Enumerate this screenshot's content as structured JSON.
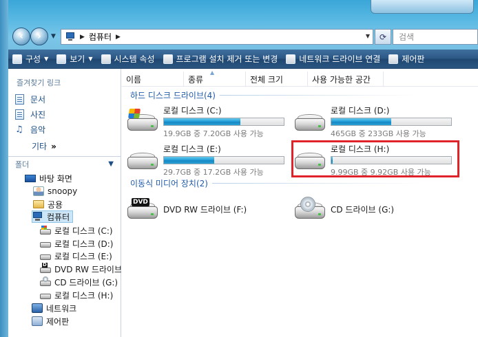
{
  "address": {
    "crumb": "컴퓨터",
    "search_placeholder": "검색"
  },
  "toolbar": {
    "organize": "구성",
    "views": "보기",
    "system_properties": "시스템 속성",
    "uninstall": "프로그램 설치 제거 또는 변경",
    "map_drive": "네트워크 드라이브 연결",
    "control_panel": "제어판"
  },
  "nav": {
    "favorites_header": "즐겨찾기 링크",
    "favorites": [
      {
        "label": "문서",
        "icon": "documents-icon"
      },
      {
        "label": "사진",
        "icon": "pictures-icon"
      },
      {
        "label": "음악",
        "icon": "music-icon"
      }
    ],
    "more": "기타",
    "more_chevron": "»",
    "folders_header": "폴더",
    "tree": [
      {
        "label": "바탕 화면",
        "icon": "desktop-icon"
      },
      {
        "label": "snoopy",
        "icon": "user-folder-icon"
      },
      {
        "label": "공용",
        "icon": "folder-icon"
      },
      {
        "label": "컴퓨터",
        "icon": "computer-icon",
        "selected": true
      },
      {
        "label": "로컬 디스크 (C:)",
        "icon": "windows-drive-icon"
      },
      {
        "label": "로컬 디스크 (D:)",
        "icon": "hard-drive-icon"
      },
      {
        "label": "로컬 디스크 (E:)",
        "icon": "hard-drive-icon"
      },
      {
        "label": "DVD RW 드라이브",
        "icon": "dvd-drive-icon"
      },
      {
        "label": "CD 드라이브 (G:)",
        "icon": "cd-drive-icon"
      },
      {
        "label": "로컬 디스크 (H:)",
        "icon": "hard-drive-icon"
      },
      {
        "label": "네트워크",
        "icon": "network-icon"
      },
      {
        "label": "제어판",
        "icon": "control-panel-icon"
      }
    ]
  },
  "columns": [
    "이름",
    "종류",
    "전체 크기",
    "사용 가능한 공간"
  ],
  "groups": {
    "hard_disks": "하드 디스크 드라이브(4)",
    "removable": "이동식 미디어 장치(2)"
  },
  "drives": [
    {
      "name": "로컬 디스크 (C:)",
      "free_text": "19.9GB 중 7.20GB 사용 가능",
      "used_fraction": 0.64,
      "icon": "windows-drive-icon"
    },
    {
      "name": "로컬 디스크 (D:)",
      "free_text": "465GB 중 233GB 사용 가능",
      "used_fraction": 0.5,
      "icon": "hard-drive-icon"
    },
    {
      "name": "로컬 디스크 (E:)",
      "free_text": "29.7GB 중 17.2GB 사용 가능",
      "used_fraction": 0.42,
      "icon": "hard-drive-icon"
    },
    {
      "name": "로컬 디스크 (H:)",
      "free_text": "9.99GB 중 9.92GB 사용 가능",
      "used_fraction": 0.01,
      "icon": "hard-drive-icon"
    }
  ],
  "removable": [
    {
      "name": "DVD RW 드라이브 (F:)",
      "icon": "dvd-drive-icon"
    },
    {
      "name": "CD 드라이브 (G:)",
      "icon": "cd-drive-icon"
    }
  ],
  "highlight_color": "#e0222a"
}
